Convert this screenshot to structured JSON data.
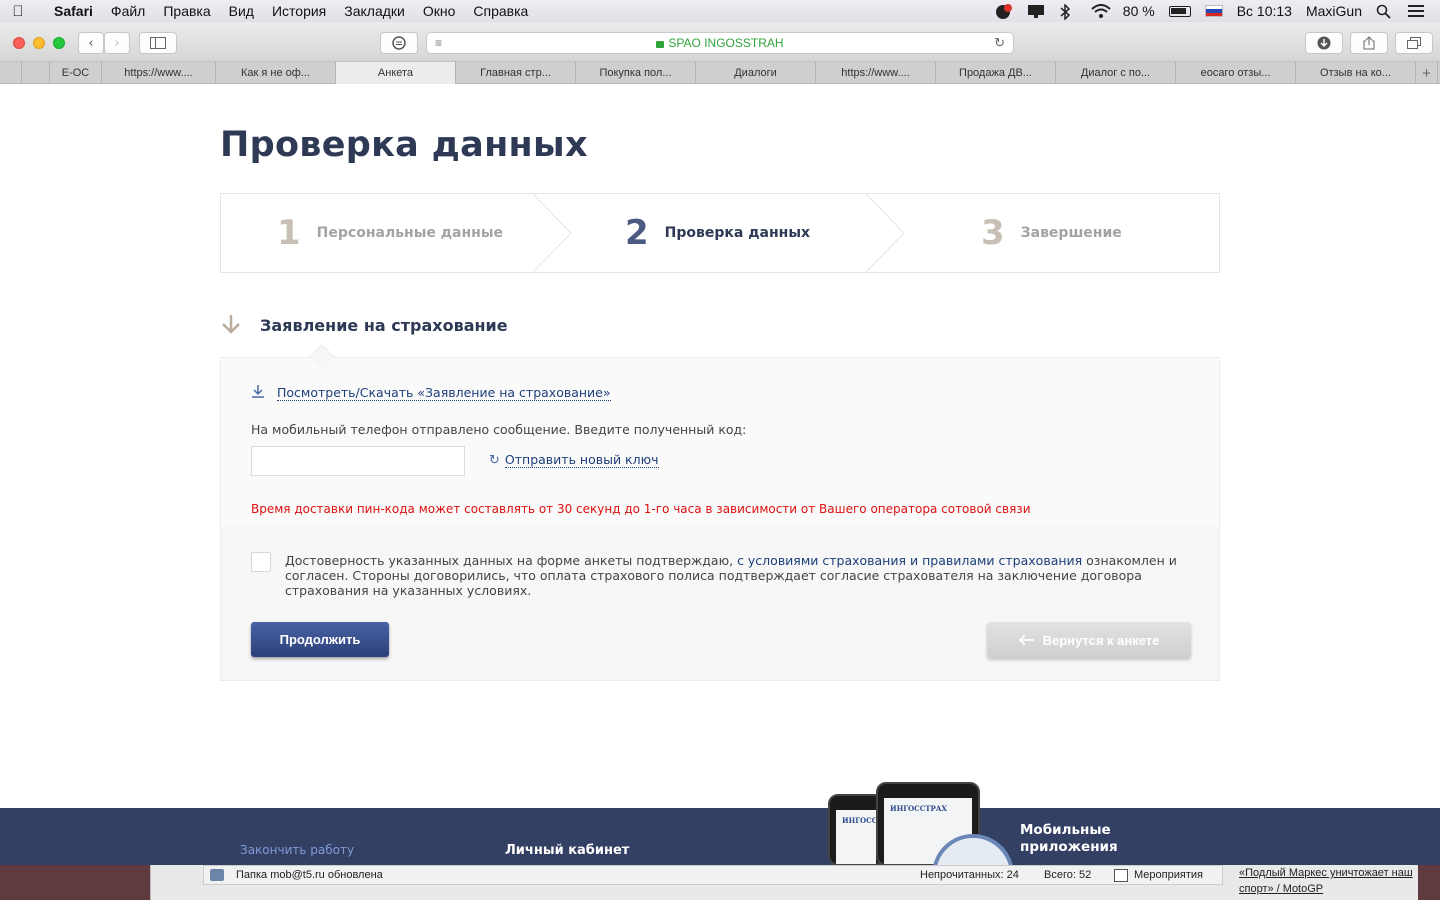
{
  "menubar": {
    "app_name": "Safari",
    "menus": [
      "Файл",
      "Правка",
      "Вид",
      "История",
      "Закладки",
      "Окно",
      "Справка"
    ],
    "battery": "80 %",
    "clock": "Вс 10:13",
    "user": "MaxiGun"
  },
  "browser": {
    "address": "SPAO INGOSSTRAH",
    "tabs": [
      {
        "label": ""
      },
      {
        "label": "E-OC"
      },
      {
        "label": "https://www...."
      },
      {
        "label": "Как я не оф..."
      },
      {
        "label": "Анкета",
        "active": true
      },
      {
        "label": "Главная стр..."
      },
      {
        "label": "Покупка пол..."
      },
      {
        "label": "Диалоги"
      },
      {
        "label": "https://www...."
      },
      {
        "label": "Продажа ДВ..."
      },
      {
        "label": "Диалог с по..."
      },
      {
        "label": "еосаго отзы..."
      },
      {
        "label": "Отзыв на ко..."
      }
    ]
  },
  "page": {
    "title": "Проверка данных",
    "steps": [
      {
        "num": "1",
        "label": "Персональные данные",
        "state": "done"
      },
      {
        "num": "2",
        "label": "Проверка данных",
        "state": "active"
      },
      {
        "num": "3",
        "label": "Завершение",
        "state": "pending"
      }
    ],
    "section_title": "Заявление на страхование",
    "download": {
      "prefix": "Посмотреть/Скачать",
      "document": "«Заявление на страхование»"
    },
    "sms_label": "На мобильный телефон отправлено сообщение. Введите полученный код:",
    "code_value": "",
    "resend_label": "Отправить новый ключ",
    "warning": "Время доставки пин-кода может составлять от 30 секунд до 1-го часа в зависимости от Вашего оператора сотовой связи",
    "agreement": {
      "part1": "Достоверность указанных данных на форме анкеты подтверждаю,",
      "link1": "с условиями страхования",
      "and": "и",
      "link2": "правилами страхования",
      "part2": "ознакомлен и согласен. Стороны договорились, что оплата страхового полиса подтверждает согласие страхователя на заключение договора страхования на указанных условиях.",
      "checked": false
    },
    "continue_label": "Продолжить",
    "back_label": "Вернутся к анкете"
  },
  "footer": {
    "finish_label": "Закончить работу",
    "cabinet_label": "Личный кабинет",
    "apps_label": "Мобильные приложения",
    "phone_brand": "ИНГОССТРАХ"
  },
  "underlying": {
    "status": "Папка mob@t5.ru обновлена",
    "unread": "Непрочитанных: 24",
    "total": "Всего: 52",
    "events": "Мероприятия",
    "link": "«Подлый Маркес уничтожает наш спорт» / MotoGP"
  },
  "colors": {
    "title": "#2e3a55",
    "accent_blue": "#2b3f78",
    "link": "#1d3f7a",
    "warning": "#e01010",
    "footer_bg": "#334064",
    "url_green": "#2fa43b"
  }
}
